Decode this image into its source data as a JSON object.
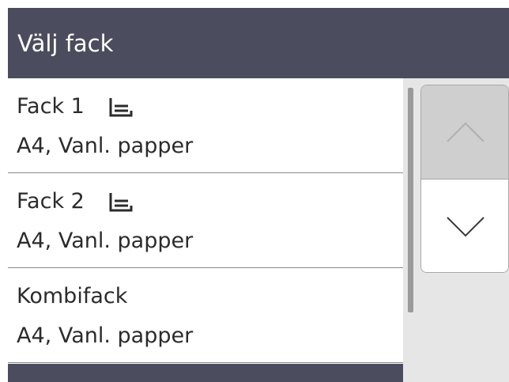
{
  "title": "Välj fack",
  "trays": [
    {
      "name": "Fack 1",
      "detail": "A4, Vanl. papper",
      "icon": "tray-icon"
    },
    {
      "name": "Fack 2",
      "detail": "A4, Vanl. papper",
      "icon": "tray-icon"
    },
    {
      "name": "Kombifack",
      "detail": "A4, Vanl. papper"
    }
  ],
  "scroll": {
    "up_icon": "chevron-up-icon",
    "down_icon": "chevron-down-icon"
  },
  "colors": {
    "header_bg": "#4b4d5e",
    "side_bg": "#e6e6e6",
    "up_button_bg": "#cfcfcf"
  }
}
